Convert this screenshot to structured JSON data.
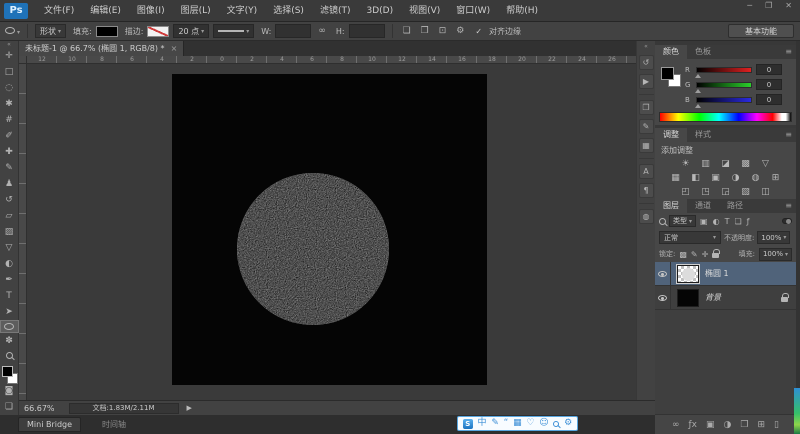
{
  "app": {
    "logo": "Ps",
    "window_controls": {
      "minimize": "─",
      "restore": "❐",
      "close": "✕"
    }
  },
  "menubar": {
    "items": [
      "文件(F)",
      "编辑(E)",
      "图像(I)",
      "图层(L)",
      "文字(Y)",
      "选择(S)",
      "滤镜(T)",
      "3D(D)",
      "视图(V)",
      "窗口(W)",
      "帮助(H)"
    ]
  },
  "options": {
    "mode": "形状",
    "fill_label": "填充:",
    "stroke_label": "描边:",
    "stroke_size": "20 点",
    "w_label": "W:",
    "w_value": "",
    "link_glyph": "∞",
    "h_label": "H:",
    "h_value": "",
    "icons": [
      "❏",
      "❐",
      "⊡",
      "⚙"
    ],
    "check_glyph": "✓",
    "align_edges_label": "对齐边缘",
    "workspace": "基本功能"
  },
  "doc": {
    "tab_title": "未标题-1 @ 66.7% (椭圆 1, RGB/8) *",
    "tab_close": "×",
    "ruler_top": [
      "12",
      "10",
      "8",
      "6",
      "4",
      "2",
      "0",
      "2",
      "4",
      "6",
      "8",
      "10",
      "12",
      "14",
      "16",
      "18",
      "20",
      "22",
      "24",
      "26"
    ]
  },
  "toolbar": {
    "collapse_glyph": "«",
    "quick_mask_glyph": "◙",
    "screen_mode_glyph": "❏",
    "tools": [
      {
        "name": "move-tool",
        "glyph": "✛"
      },
      {
        "name": "rectangular-marquee-tool",
        "glyph": "□"
      },
      {
        "name": "lasso-tool",
        "glyph": "◌"
      },
      {
        "name": "quick-selection-tool",
        "glyph": "✱"
      },
      {
        "name": "crop-tool",
        "glyph": "#"
      },
      {
        "name": "eyedropper-tool",
        "glyph": "✐"
      },
      {
        "name": "spot-healing-brush-tool",
        "glyph": "✚"
      },
      {
        "name": "brush-tool",
        "glyph": "✎"
      },
      {
        "name": "clone-stamp-tool",
        "glyph": "♟"
      },
      {
        "name": "history-brush-tool",
        "glyph": "↺"
      },
      {
        "name": "eraser-tool",
        "glyph": "▱"
      },
      {
        "name": "gradient-tool",
        "glyph": "▨"
      },
      {
        "name": "blur-tool",
        "glyph": "▽"
      },
      {
        "name": "dodge-tool",
        "glyph": "◐"
      },
      {
        "name": "pen-tool",
        "glyph": "✒"
      },
      {
        "name": "type-tool",
        "glyph": "T"
      },
      {
        "name": "path-selection-tool",
        "glyph": "➤"
      },
      {
        "name": "ellipse-tool",
        "icon": "css-oval",
        "selected": true
      },
      {
        "name": "hand-tool",
        "glyph": "✽"
      },
      {
        "name": "zoom-tool",
        "icon": "css-magnifier"
      }
    ]
  },
  "dock": {
    "collapse_glyph": "«",
    "icons": [
      {
        "name": "history-panel",
        "glyph": "↺"
      },
      {
        "name": "actions-panel",
        "glyph": "▶"
      },
      {
        "name": "clone-source-panel",
        "glyph": "❐"
      },
      {
        "name": "brush-presets-panel",
        "glyph": "✎"
      },
      {
        "name": "layer-comps-panel",
        "glyph": "▦"
      },
      {
        "name": "character-panel",
        "glyph": "A"
      },
      {
        "name": "paragraph-panel",
        "glyph": "¶"
      },
      {
        "name": "kuler-panel",
        "glyph": "◍"
      }
    ]
  },
  "panels": {
    "color": {
      "tabs": [
        "颜色",
        "色板"
      ],
      "menu_glyph": "≡",
      "channels": [
        {
          "label": "R",
          "value": "0"
        },
        {
          "label": "G",
          "value": "0"
        },
        {
          "label": "B",
          "value": "0"
        }
      ]
    },
    "adjust": {
      "tabs": [
        "调整",
        "样式"
      ],
      "hint": "添加调整",
      "icons": [
        "☀",
        "▥",
        "◪",
        "▩",
        "▽",
        "▦",
        "◧",
        "▣",
        "◑",
        "◍",
        "⊞",
        "◰",
        "◳",
        "◲",
        "▧",
        "◫"
      ]
    },
    "layers": {
      "tabs": [
        "图层",
        "通道",
        "路径"
      ],
      "filter_kind": "类型",
      "filter_icons": [
        "▣",
        "◐",
        "T",
        "❏",
        "ƒ"
      ],
      "blend_mode": "正常",
      "opacity_label": "不透明度:",
      "opacity": "100%",
      "lock_label": "锁定:",
      "lock_icons": [
        "▩",
        "✎",
        "✛"
      ],
      "fill_label": "填充:",
      "fill": "100%",
      "rows": [
        {
          "name": "椭圆 1",
          "selected": true
        },
        {
          "name": "背景",
          "locked": true
        }
      ],
      "bottom_icons": [
        "∞",
        "ƒx",
        "▣",
        "◑",
        "❒",
        "⊞",
        "▯"
      ]
    }
  },
  "status": {
    "zoom": "66.67%",
    "doc_info": "文档:1.83M/2.11M",
    "arrow": "▶"
  },
  "bottom": {
    "mini_bridge": "Mini Bridge",
    "timeline": "时间轴"
  },
  "ime": {
    "icons": [
      {
        "name": "ime-logo",
        "glyph": "S"
      },
      {
        "name": "chinese-mode",
        "glyph": "中"
      },
      {
        "name": "handwriting",
        "glyph": "✎"
      },
      {
        "name": "punctuation",
        "glyph": "“"
      },
      {
        "name": "soft-keyboard",
        "glyph": "▦"
      },
      {
        "name": "skin",
        "glyph": "♡"
      },
      {
        "name": "account",
        "glyph": "☺"
      },
      {
        "name": "search",
        "icon": "css-magnifier"
      },
      {
        "name": "settings",
        "glyph": "⚙"
      }
    ]
  },
  "colors": {
    "logo_bg": "#1f72b8",
    "selected_layer_row": "#50637a",
    "ime_border": "#58a6e0",
    "canvas_bg": "#3a3a3a",
    "document_bg": "#050505",
    "circle_fill": "#f0f0f0"
  }
}
